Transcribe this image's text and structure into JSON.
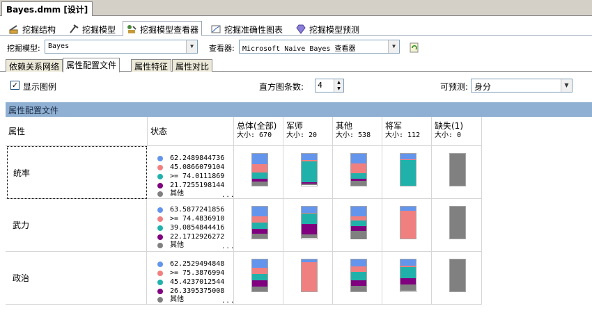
{
  "window": {
    "doc_tab": "Bayes.dmm [设计]"
  },
  "main_tabs": [
    {
      "label": "挖掘结构",
      "icon": "mining-structure-icon"
    },
    {
      "label": "挖掘模型",
      "icon": "mining-model-icon"
    },
    {
      "label": "挖掘模型查看器",
      "icon": "model-viewer-icon"
    },
    {
      "label": "挖掘准确性图表",
      "icon": "accuracy-chart-icon"
    },
    {
      "label": "挖掘模型预测",
      "icon": "prediction-icon"
    }
  ],
  "toolbar": {
    "model_label": "挖掘模型:",
    "model_value": "Bayes",
    "viewer_label": "查看器:",
    "viewer_value": "Microsoft Naive Bayes 查看器"
  },
  "sub_tabs": [
    "依赖关系网络",
    "属性配置文件",
    "属性特征",
    "属性对比"
  ],
  "options": {
    "show_legend_label": "显示图例",
    "show_legend_checked": true,
    "histogram_label": "直方图条数:",
    "histogram_value": "4",
    "predictable_label": "可预测:",
    "predictable_value": "身分"
  },
  "section_title": "属性配置文件",
  "colors": {
    "blue": "#6495ed",
    "salmon": "#f08080",
    "teal": "#20b2aa",
    "purple": "#800080",
    "gray": "#808080"
  },
  "columns": {
    "attribute": "属性",
    "states": "状态",
    "groups": [
      {
        "name": "总体(全部)",
        "size": "大小: 670"
      },
      {
        "name": "军师",
        "size": "大小: 20"
      },
      {
        "name": "其他",
        "size": "大小: 538"
      },
      {
        "name": "将军",
        "size": "大小: 112"
      },
      {
        "name": "缺失(1)",
        "size": "大小: 0"
      }
    ]
  },
  "rows": [
    {
      "attribute": "统率",
      "states": [
        {
          "label": "62.2489844736",
          "color": "blue"
        },
        {
          "label": "45.0866079104",
          "color": "salmon"
        },
        {
          "label": ">= 74.0111869",
          "color": "teal"
        },
        {
          "label": "21.7255198144",
          "color": "purple"
        },
        {
          "label": "其他",
          "color": "gray"
        }
      ],
      "more": "...",
      "distributions": [
        [
          0.33,
          0.25,
          0.2,
          0.08,
          0.14
        ],
        [
          0.2,
          0.05,
          0.65,
          0.05,
          0.05
        ],
        [
          0.3,
          0.3,
          0.18,
          0.07,
          0.15
        ],
        [
          0.18,
          0.02,
          0.8,
          0.0,
          0.0
        ],
        [
          0.0,
          0.0,
          0.0,
          0.0,
          1.0
        ]
      ]
    },
    {
      "attribute": "武力",
      "states": [
        {
          "label": "63.5877241856",
          "color": "blue"
        },
        {
          "label": ">= 74.4836910",
          "color": "salmon"
        },
        {
          "label": "39.0854844416",
          "color": "teal"
        },
        {
          "label": "22.1712926272",
          "color": "purple"
        },
        {
          "label": "其他",
          "color": "gray"
        }
      ],
      "more": "...",
      "distributions": [
        [
          0.3,
          0.2,
          0.2,
          0.15,
          0.15
        ],
        [
          0.2,
          0.03,
          0.33,
          0.33,
          0.11
        ],
        [
          0.3,
          0.12,
          0.18,
          0.15,
          0.25
        ],
        [
          0.12,
          0.88,
          0.0,
          0.0,
          0.0
        ],
        [
          0.0,
          0.0,
          0.0,
          0.0,
          1.0
        ]
      ]
    },
    {
      "attribute": "政治",
      "states": [
        {
          "label": "62.2529494848",
          "color": "blue"
        },
        {
          "label": ">= 75.3876994",
          "color": "salmon"
        },
        {
          "label": "45.4237012544",
          "color": "teal"
        },
        {
          "label": "26.3395375008",
          "color": "purple"
        },
        {
          "label": "其他",
          "color": "gray"
        }
      ],
      "more": "...",
      "distributions": [
        [
          0.25,
          0.2,
          0.2,
          0.2,
          0.15
        ],
        [
          0.08,
          0.92,
          0.0,
          0.0,
          0.0
        ],
        [
          0.22,
          0.18,
          0.25,
          0.18,
          0.17
        ],
        [
          0.2,
          0.05,
          0.35,
          0.2,
          0.2
        ],
        [
          0.0,
          0.0,
          0.0,
          0.0,
          1.0
        ]
      ]
    }
  ]
}
